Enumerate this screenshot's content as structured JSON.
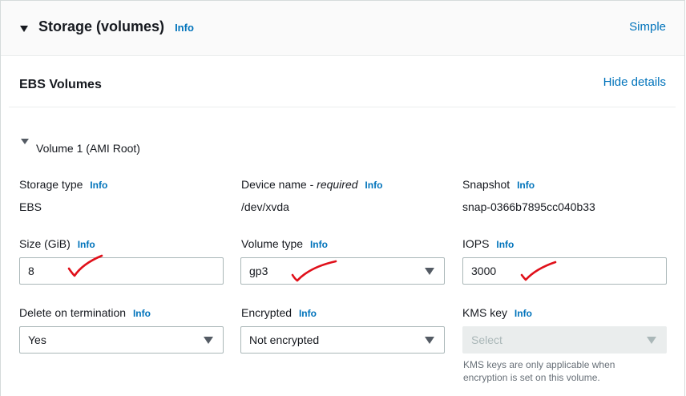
{
  "header": {
    "title": "Storage (volumes)",
    "info": "Info",
    "mode_link": "Simple"
  },
  "ebs": {
    "title": "EBS Volumes",
    "toggle_link": "Hide details"
  },
  "volume": {
    "title": "Volume 1 (AMI Root)",
    "storage_type": {
      "label": "Storage type",
      "info": "Info",
      "value": "EBS"
    },
    "device_name": {
      "label": "Device name - ",
      "label_em": "required",
      "info": "Info",
      "value": "/dev/xvda"
    },
    "snapshot": {
      "label": "Snapshot",
      "info": "Info",
      "value": "snap-0366b7895cc040b33"
    },
    "size": {
      "label": "Size (GiB)",
      "info": "Info",
      "value": "8"
    },
    "volume_type": {
      "label": "Volume type",
      "info": "Info",
      "value": "gp3"
    },
    "iops": {
      "label": "IOPS",
      "info": "Info",
      "value": "3000"
    },
    "delete_on_termination": {
      "label": "Delete on termination",
      "info": "Info",
      "value": "Yes"
    },
    "encrypted": {
      "label": "Encrypted",
      "info": "Info",
      "value": "Not encrypted"
    },
    "kms_key": {
      "label": "KMS key",
      "info": "Info",
      "placeholder": "Select",
      "hint_line1": "KMS keys are only applicable when",
      "hint_line2": "encryption is set on this volume."
    }
  },
  "colors": {
    "link": "#0073bb",
    "text": "#16191f",
    "annotation": "#e0101a"
  },
  "icons": {
    "section_toggle": "caret-down-icon",
    "select_arrow": "caret-down-icon",
    "annotation_mark": "red-checkmark"
  }
}
